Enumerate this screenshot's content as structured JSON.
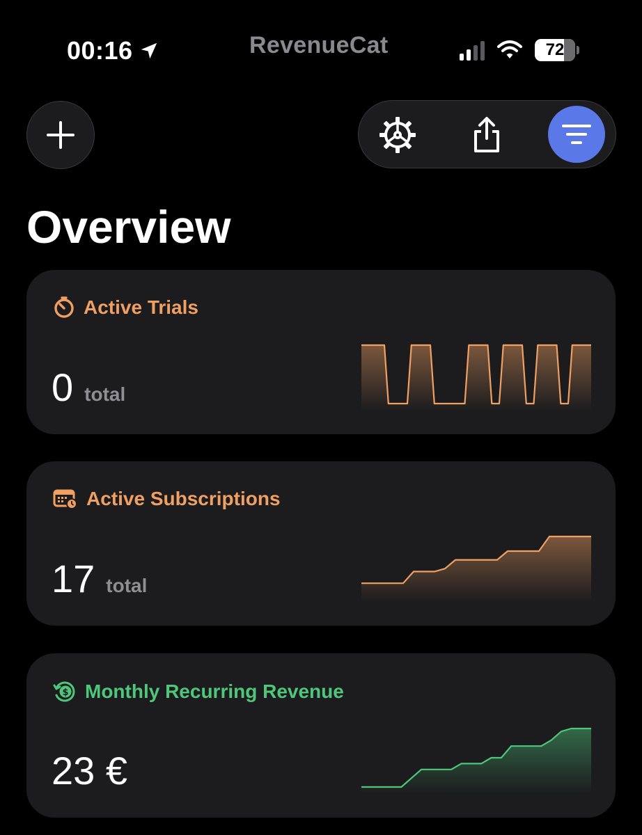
{
  "status_bar": {
    "time": "00:16",
    "carrier_brand": "RevenueCat",
    "battery_percent": "72",
    "battery_level": 0.72
  },
  "toolbar": {
    "add_icon": "plus-icon",
    "settings_icon": "gear-icon",
    "share_icon": "share-icon",
    "filter_icon": "filter-icon"
  },
  "page": {
    "title": "Overview"
  },
  "cards": [
    {
      "title": "Active Trials",
      "icon": "timer-icon",
      "value": "0",
      "unit": "total",
      "accent": "#f0a062",
      "sparkline": [
        1,
        1,
        0,
        0,
        1,
        1,
        0,
        0,
        0,
        1,
        1,
        0,
        1,
        1,
        0,
        1,
        1,
        0,
        1,
        1
      ]
    },
    {
      "title": "Active Subscriptions",
      "icon": "calendar-icon",
      "value": "17",
      "unit": "total",
      "accent": "#f0a062",
      "sparkline": [
        0.2,
        0.2,
        0.2,
        0.2,
        0.2,
        0.4,
        0.4,
        0.4,
        0.45,
        0.6,
        0.6,
        0.6,
        0.6,
        0.6,
        0.75,
        0.75,
        0.75,
        0.75,
        1,
        1,
        1,
        1,
        1
      ]
    },
    {
      "title": "Monthly Recurring Revenue",
      "icon": "dollar-cycle-icon",
      "value": "23 €",
      "unit": "",
      "accent": "#4ec77b",
      "sparkline": [
        0,
        0,
        0,
        0,
        0,
        0.15,
        0.3,
        0.3,
        0.3,
        0.3,
        0.4,
        0.4,
        0.4,
        0.5,
        0.5,
        0.7,
        0.7,
        0.7,
        0.7,
        0.8,
        0.95,
        1,
        1,
        1
      ]
    }
  ]
}
